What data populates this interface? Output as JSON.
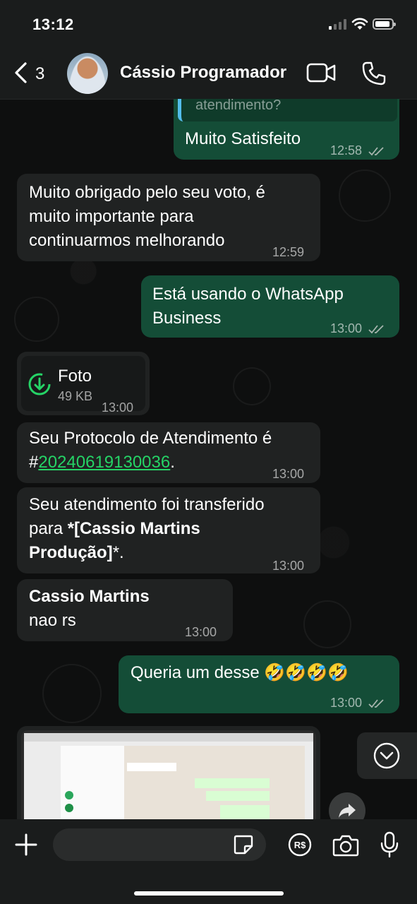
{
  "status_bar": {
    "time": "13:12"
  },
  "header": {
    "back_count": "3",
    "contact_name": "Cássio Programador",
    "icons": [
      "chevron-left-icon",
      "video-icon",
      "phone-icon"
    ]
  },
  "messages": {
    "m1": {
      "quote_text": "atendimento?",
      "text": "Muito Satisfeito",
      "time": "12:58"
    },
    "m2": {
      "line1": "Muito obrigado pelo seu voto, é",
      "line2": "muito importante para",
      "line3": "continuarmos melhorando",
      "time": "12:59"
    },
    "m3": {
      "line1": "Está usando o WhatsApp",
      "line2": "Business",
      "time": "13:00"
    },
    "m4": {
      "title": "Foto",
      "size": "49 KB",
      "time": "13:00"
    },
    "m5": {
      "line1": "Seu Protocolo de Atendimento é",
      "prefix": "#",
      "protocol": "20240619130036",
      "suffix": ".",
      "time": "13:00"
    },
    "m6": {
      "line1": "Seu atendimento foi transferido",
      "line2_plain": "para ",
      "line2_bold": "*[Cassio Martins",
      "line3_bold": "Produção]",
      "line3_plain": "*.",
      "time": "13:00"
    },
    "m7": {
      "sender": "Cassio Martins",
      "text": "nao rs",
      "time": "13:00"
    },
    "m8": {
      "text": "Queria um desse 🤣🤣🤣🤣",
      "time": "13:00"
    }
  },
  "colors": {
    "outgoing": "#144d37",
    "incoming": "#202222",
    "accent": "#25d366"
  }
}
